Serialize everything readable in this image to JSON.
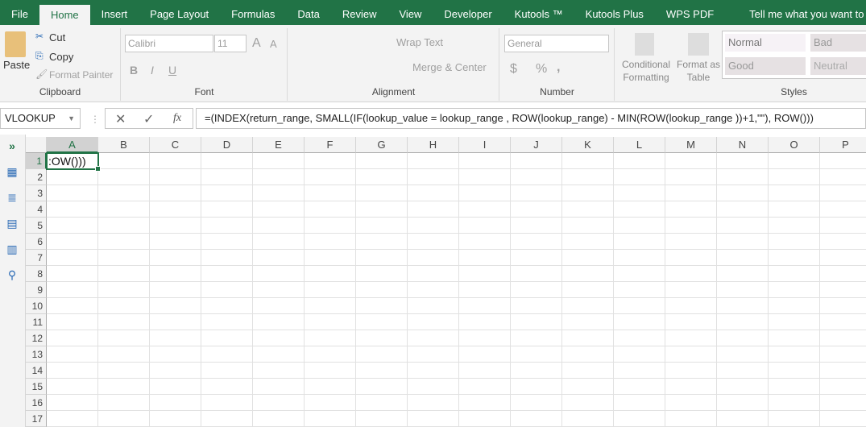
{
  "tabs": [
    "File",
    "Home",
    "Insert",
    "Page Layout",
    "Formulas",
    "Data",
    "Review",
    "View",
    "Developer",
    "Kutools ™",
    "Kutools Plus",
    "WPS PDF"
  ],
  "tell_me": "Tell me what you want to do...",
  "clipboard": {
    "paste": "Paste",
    "cut": "Cut",
    "copy": "Copy",
    "format_painter": "Format Painter",
    "label": "Clipboard"
  },
  "font": {
    "name": "Calibri",
    "size": "11",
    "label": "Font",
    "bold": "B",
    "italic": "I",
    "underline": "U"
  },
  "alignment": {
    "wrap": "Wrap Text",
    "merge": "Merge & Center",
    "label": "Alignment"
  },
  "number": {
    "format": "General",
    "currency": "$",
    "percent": "%",
    "comma": ",",
    "label": "Number"
  },
  "styles": {
    "conditional1": "Conditional",
    "conditional2": "Formatting",
    "format_as1": "Format as",
    "format_as2": "Table",
    "normal": "Normal",
    "bad": "Bad",
    "good": "Good",
    "neutral": "Neutral",
    "label": "Styles"
  },
  "formula_bar": {
    "name_box": "VLOOKUP",
    "fx": "fx",
    "formula": "=(INDEX(return_range, SMALL(IF(lookup_value = lookup_range , ROW(lookup_range) - MIN(ROW(lookup_range ))+1,\"\"), ROW()))"
  },
  "columns": [
    "A",
    "B",
    "C",
    "D",
    "E",
    "F",
    "G",
    "H",
    "I",
    "J",
    "K",
    "L",
    "M",
    "N",
    "O",
    "P"
  ],
  "rows": [
    "1",
    "2",
    "3",
    "4",
    "5",
    "6",
    "7",
    "8",
    "9",
    "10",
    "11",
    "12",
    "13",
    "14",
    "15",
    "16",
    "17"
  ],
  "cell_a1": ":OW()))",
  "colors": {
    "accent": "#217346"
  }
}
